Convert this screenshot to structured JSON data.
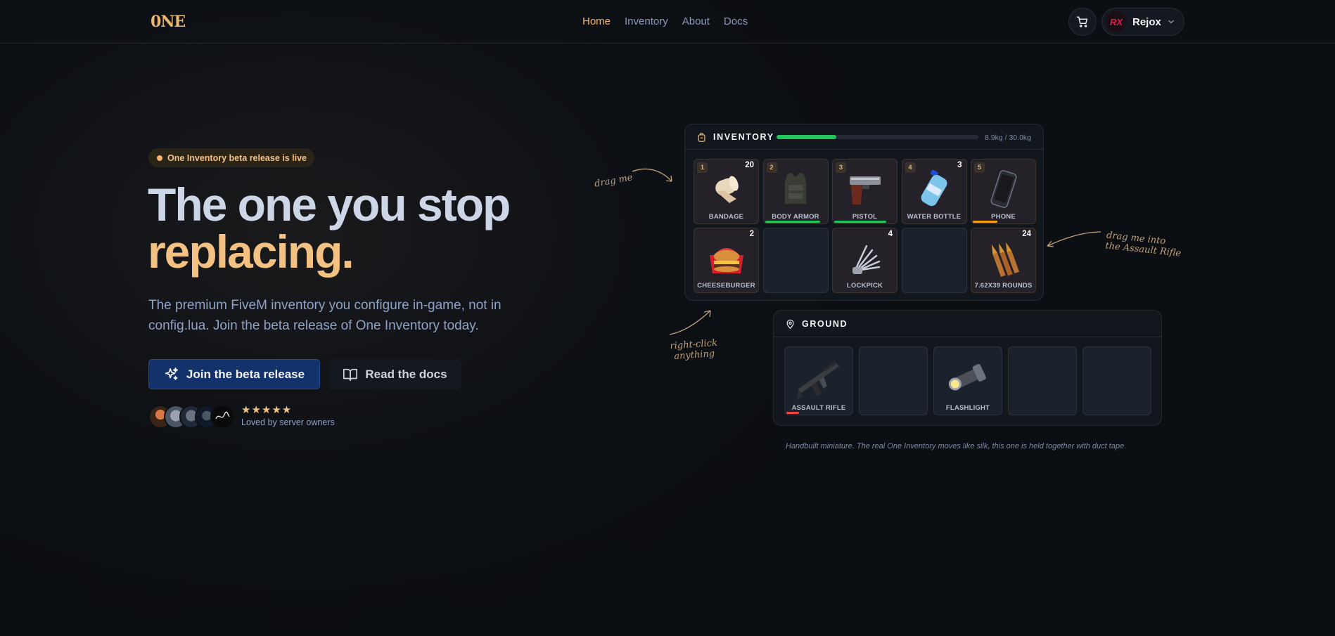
{
  "nav": {
    "logo": {
      "text": "0",
      "accent": "NE"
    },
    "links": [
      {
        "label": "Home",
        "active": true
      },
      {
        "label": "Inventory",
        "active": false
      },
      {
        "label": "About",
        "active": false
      },
      {
        "label": "Docs",
        "active": false
      }
    ],
    "cart_icon": "cart-icon",
    "user": {
      "name": "Rejox",
      "avatar_text": "RX",
      "chevron_icon": "chevron-down-icon"
    }
  },
  "hero": {
    "badge": "One Inventory beta release is live",
    "headline_line1": "The one you stop",
    "headline_line2": "replacing.",
    "subtitle": "The premium FiveM inventory you configure in-game, not in config.lua. Join the beta release of One Inventory today.",
    "primary_button": "Join the beta release",
    "secondary_button": "Read the docs",
    "stars": "★★★★★",
    "social_proof": "Loved by server owners"
  },
  "inventory": {
    "title": "INVENTORY",
    "weight_text": "8.9kg / 30.0kg",
    "weight_fraction": 0.297,
    "slots": [
      {
        "num": "1",
        "count": "20",
        "label": "BANDAGE",
        "icon": "bandage-icon"
      },
      {
        "num": "2",
        "count": "",
        "label": "BODY ARMOR",
        "icon": "body-armor-icon",
        "durability": 0.9,
        "dur_color": "#22c55e"
      },
      {
        "num": "3",
        "count": "",
        "label": "PISTOL",
        "icon": "pistol-icon",
        "durability": 0.85,
        "dur_color": "#22c55e"
      },
      {
        "num": "4",
        "count": "3",
        "label": "WATER BOTTLE",
        "icon": "water-bottle-icon"
      },
      {
        "num": "5",
        "count": "",
        "label": "PHONE",
        "icon": "phone-icon",
        "durability": 0.4,
        "dur_color": "#f59e0b"
      },
      {
        "num": "",
        "count": "2",
        "label": "CHEESEBURGER",
        "icon": "cheeseburger-icon"
      },
      {
        "num": "",
        "count": "",
        "label": "",
        "icon": ""
      },
      {
        "num": "",
        "count": "4",
        "label": "LOCKPICK",
        "icon": "lockpick-icon"
      },
      {
        "num": "",
        "count": "",
        "label": "",
        "icon": ""
      },
      {
        "num": "",
        "count": "24",
        "label": "7.62X39 ROUNDS",
        "icon": "rounds-icon"
      }
    ]
  },
  "ground": {
    "title": "GROUND",
    "slots": [
      {
        "label": "ASSAULT RIFLE",
        "icon": "assault-rifle-icon",
        "durability": 0.2,
        "dur_color": "#ef4444"
      },
      {
        "label": "",
        "icon": ""
      },
      {
        "label": "FLASHLIGHT",
        "icon": "flashlight-icon"
      },
      {
        "label": "",
        "icon": ""
      },
      {
        "label": "",
        "icon": ""
      }
    ]
  },
  "annotations": {
    "drag_me": "drag me",
    "drag_into_line1": "drag me into",
    "drag_into_line2": "the Assault Rifle",
    "right_click_line1": "right-click",
    "right_click_line2": "anything"
  },
  "caption": "Handbuilt miniature. The real One Inventory moves like silk, this one is held together with duct tape."
}
